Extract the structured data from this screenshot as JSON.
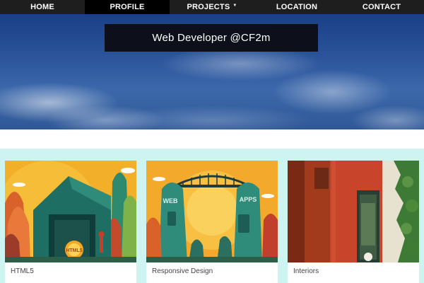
{
  "nav": {
    "items": [
      {
        "label": "HOME"
      },
      {
        "label": "PROFILE",
        "active": true
      },
      {
        "label": "PROJECTS",
        "has_dropdown": true
      },
      {
        "label": "LOCATION"
      },
      {
        "label": "CONTACT"
      }
    ]
  },
  "hero": {
    "title": "Web Developer @CF2m"
  },
  "portfolio": {
    "cards": [
      {
        "label": "HTML5",
        "image": "html5-illustration"
      },
      {
        "label": "Responsive Design",
        "image": "web-apps-bridge-illustration"
      },
      {
        "label": "Interiors",
        "image": "interior-wall-photo"
      }
    ]
  },
  "colors": {
    "nav_bg": "#1e1e1e",
    "nav_active_bg": "#000000",
    "band_bg": "#cdf4f1",
    "hero_box_bg": "#0d0f1a"
  }
}
